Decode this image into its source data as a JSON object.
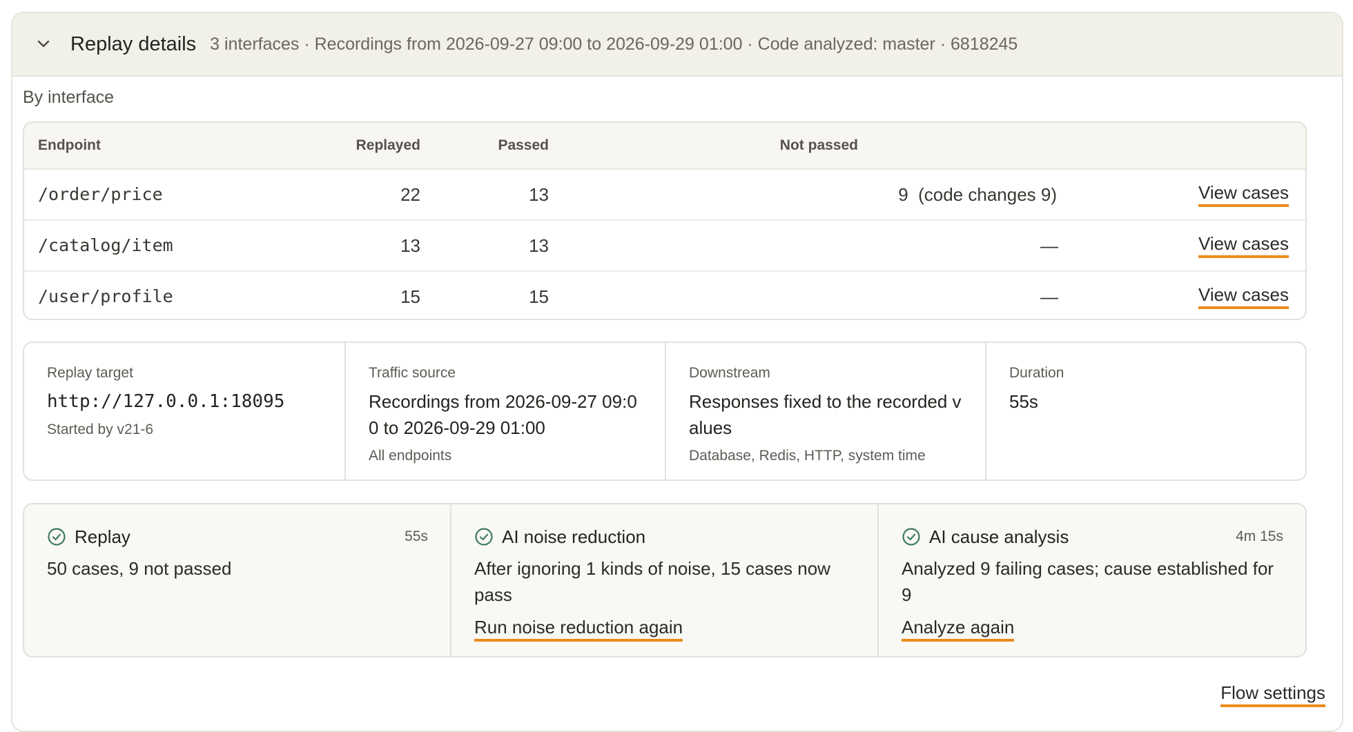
{
  "header": {
    "title": "Replay details",
    "summary": "3 interfaces · Recordings from 2026-09-27 09:00 to 2026-09-29 01:00 · Code analyzed: master · 6818245"
  },
  "by_interface": {
    "label": "By interface",
    "columns": {
      "endpoint": "Endpoint",
      "replayed": "Replayed",
      "passed": "Passed",
      "not_passed": "Not passed"
    },
    "rows": [
      {
        "endpoint": "/order/price",
        "replayed": "22",
        "passed": "13",
        "not_passed": "9  (code changes 9)",
        "action": "View cases"
      },
      {
        "endpoint": "/catalog/item",
        "replayed": "13",
        "passed": "13",
        "not_passed": "—",
        "action": "View cases"
      },
      {
        "endpoint": "/user/profile",
        "replayed": "15",
        "passed": "15",
        "not_passed": "—",
        "action": "View cases"
      }
    ]
  },
  "info": {
    "target": {
      "label": "Replay target",
      "value": "http://127.0.0.1:18095",
      "sub": "Started by v21-6"
    },
    "traffic": {
      "label": "Traffic source",
      "value": "Recordings from 2026-09-27 09:00 to 2026-09-29 01:00",
      "sub": "All endpoints"
    },
    "downstream": {
      "label": "Downstream",
      "value": "Responses fixed to the recorded values",
      "sub": "Database, Redis, HTTP, system time"
    },
    "duration": {
      "label": "Duration",
      "value": "55s"
    }
  },
  "steps": {
    "replay": {
      "title": "Replay",
      "time": "55s",
      "desc": "50 cases, 9 not passed"
    },
    "noise": {
      "title": "AI noise reduction",
      "time": "",
      "desc": "After ignoring 1 kinds of noise, 15 cases now pass",
      "action": "Run noise reduction again"
    },
    "cause": {
      "title": "AI cause analysis",
      "time": "4m 15s",
      "desc": "Analyzed 9 failing cases; cause established for 9",
      "action": "Analyze again"
    }
  },
  "footer": {
    "flow_settings": "Flow settings"
  },
  "colors": {
    "accent_underline": "#ec8a1c",
    "check_green": "#3e7a5c",
    "header_bg": "#f1f0e9"
  }
}
